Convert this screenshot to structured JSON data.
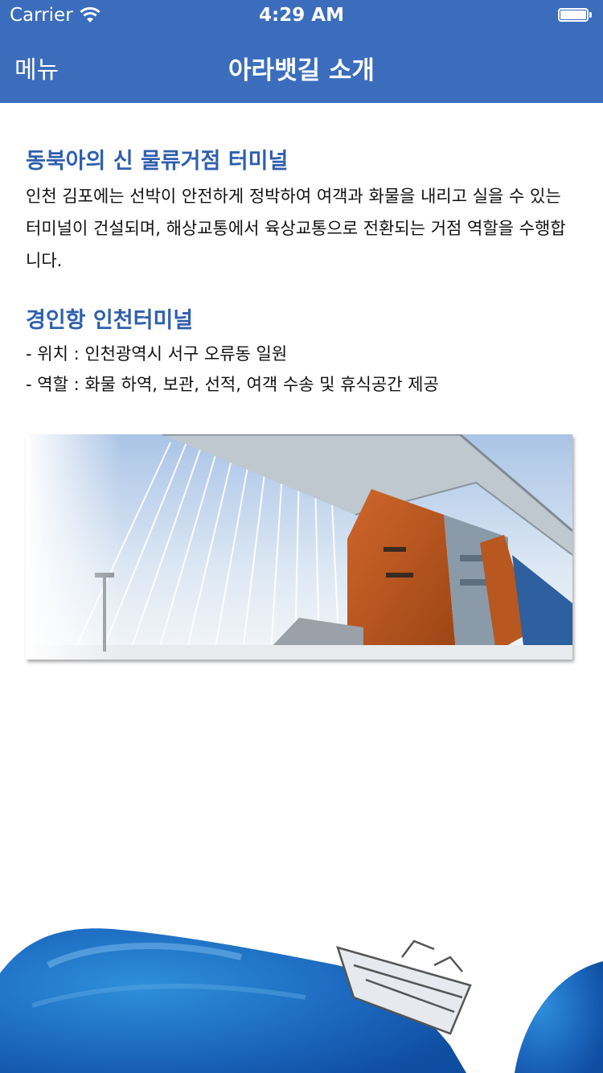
{
  "status_bar": {
    "carrier": "Carrier",
    "time": "4:29 AM",
    "battery_level": 1.0
  },
  "navbar": {
    "menu_label": "메뉴",
    "title": "아라뱃길 소개"
  },
  "section1": {
    "title": "동북아의 신 물류거점 터미널",
    "body": "인천 김포에는 선박이 안전하게 정박하여 여객과 화물을 내리고 실을 수 있는 터미널이 건설되며, 해상교통에서 육상교통으로 전환되는 거점 역할을 수행합니다."
  },
  "section2": {
    "title": "경인항 인천터미널",
    "location": "- 위치 : 인천광역시 서구 오류동 일원",
    "role": "- 역할 : 화물 하역, 보관, 선적, 여객 수송 및 휴식공간 제공"
  },
  "colors": {
    "nav_background": "#3c6dbd",
    "heading": "#2f5fae",
    "terminal_facade": "#c0561e",
    "wave": "#1e78c8"
  },
  "icons": [
    "wifi-icon",
    "battery-icon"
  ]
}
